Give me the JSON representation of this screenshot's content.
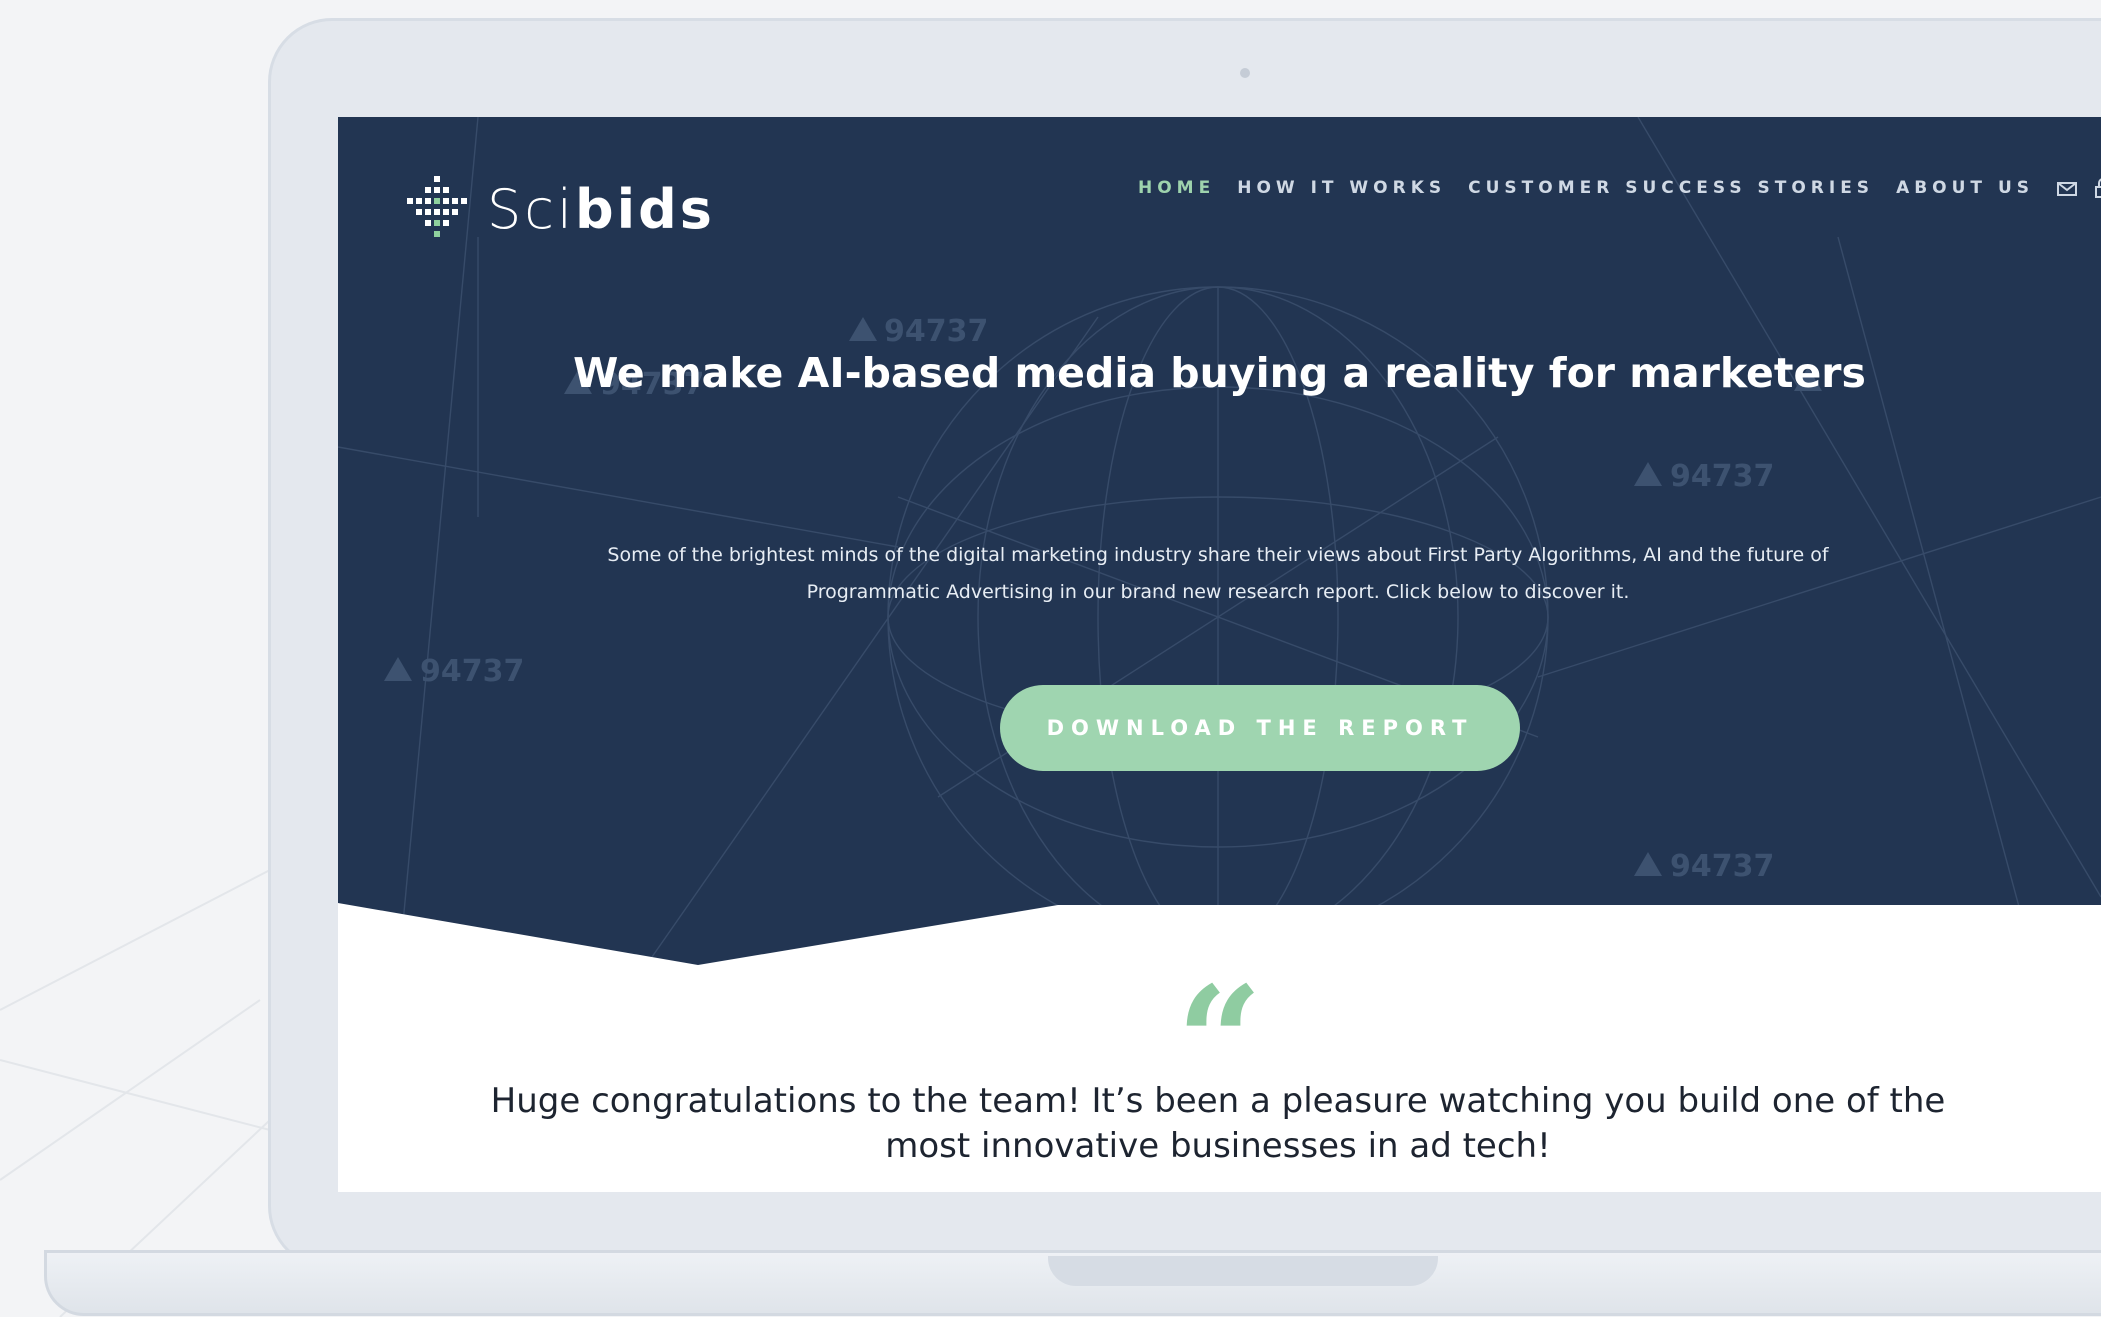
{
  "brand": {
    "name_light": "Sci",
    "name_bold": "bids",
    "logo_icon": "scibids-grid-logo-icon"
  },
  "nav": {
    "items": [
      {
        "label": "HOME",
        "active": true
      },
      {
        "label": "HOW IT WORKS",
        "active": false
      },
      {
        "label": "CUSTOMER SUCCESS STORIES",
        "active": false
      },
      {
        "label": "ABOUT US",
        "active": false
      }
    ],
    "icons": [
      "mail-icon",
      "lock-icon"
    ]
  },
  "hero": {
    "title": "We make AI-based media buying a reality for marketers",
    "description_line1": "Some of the brightest minds of the digital marketing industry share their views about First Party Algorithms, AI and the future of",
    "description_line2": "Programmatic Advertising in our brand new research report. Click below to discover it.",
    "cta_label": "DOWNLOAD THE REPORT",
    "background_label": "94737"
  },
  "testimonial": {
    "quote_mark": "“",
    "text_line1": "Huge congratulations to the team! It’s been a pleasure watching you build one of the",
    "text_line2": "most innovative businesses in ad tech!"
  },
  "colors": {
    "hero_bg": "#223552",
    "accent": "#9fd5b0",
    "nav_text": "#cfd8e4",
    "page_bg": "#f3f4f6"
  }
}
